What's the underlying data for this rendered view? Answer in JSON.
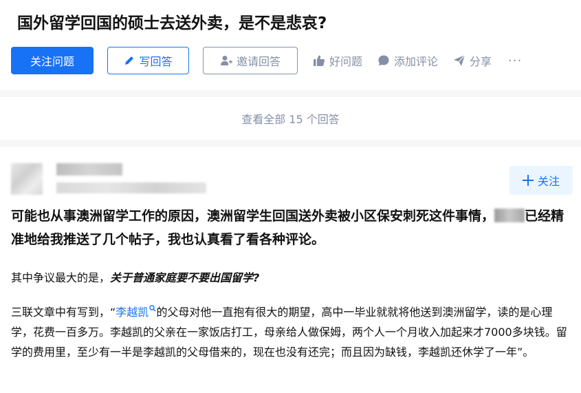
{
  "question": {
    "title": "国外留学回国的硕士去送外卖，是不是悲哀?",
    "actions": {
      "follow_question": "关注问题",
      "write_answer": "写回答",
      "invite_answer": "邀请回答",
      "good_question": "好问题",
      "add_comment": "添加评论",
      "share": "分享",
      "more": "···"
    }
  },
  "view_all": {
    "label": "查看全部 15 个回答"
  },
  "answer": {
    "follow_label": "关注",
    "lead_part1": "可能也从事澳洲留学工作的原因，澳洲留学生回国送外卖被小区保安刺死这件事情，",
    "lead_part2": "已经精准地给我推送了几个帖子，我也认真看了看各种评论。",
    "p1_text": "其中争议最大的是，",
    "p1_emphasis": "关于普通家庭要不要出国留学?",
    "p2_prefix": "三联文章中有写到，“",
    "p2_link": "李越凯",
    "p2_rest": "的父母对他一直抱有很大的期望，高中一毕业就就将他送到澳洲留学，读的是心理学，花费一百多万。李越凯的父亲在一家饭店打工，母亲给人做保姆，两个人一个月收入加起来才7000多块钱。留学的费用里，至少有一半是李越凯的父母借来的，现在也没有还完；而且因为缺钱，李越凯还休学了一年”。"
  },
  "colors": {
    "accent": "#1772f6",
    "muted": "#8590a6",
    "follow_bg": "#ebf5ff"
  }
}
